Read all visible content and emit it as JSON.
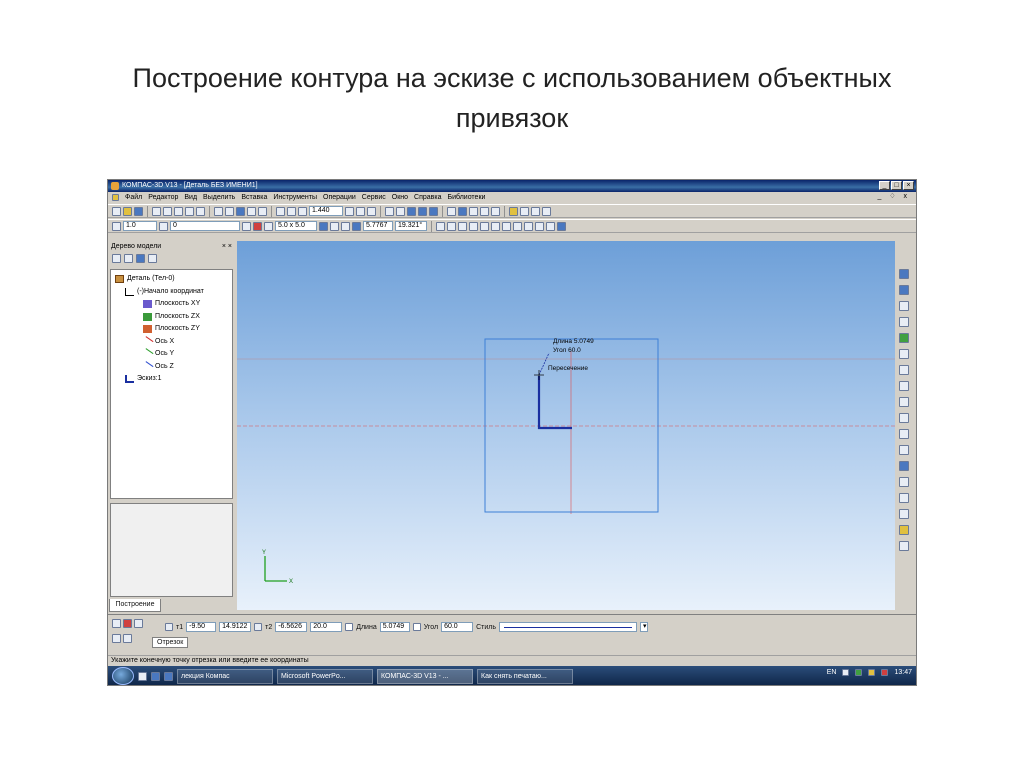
{
  "slide": {
    "title_line1": "Построение  контура на эскизе с использованием объектных",
    "title_line2": "привязок"
  },
  "window": {
    "title": "КОМПАС-3D V13 - [Деталь БЕЗ ИМЕНИ1]",
    "buttons": [
      "_",
      "□",
      "×"
    ]
  },
  "menu": {
    "items": [
      "Файл",
      "Редактор",
      "Вид",
      "Выделить",
      "Вставка",
      "Инструменты",
      "Операции",
      "Сервис",
      "Окно",
      "Справка",
      "Библиотеки"
    ],
    "mdi": "_ ♢ x"
  },
  "toolbar1": {
    "zoom": "1.440"
  },
  "toolbar2": {
    "scale": "1.0",
    "layer": "0",
    "grid": "5.0 x 5.0",
    "step": "5.7767",
    "angle": "19.321°"
  },
  "tree": {
    "header": "Дерево модели",
    "close": "× ×",
    "nodes": [
      {
        "label": "Деталь (Тел-0)",
        "icon": "part-icon",
        "level": 0
      },
      {
        "label": "(-)Начало координат",
        "icon": "origin-icon",
        "level": 1
      },
      {
        "label": "Плоскость XY",
        "icon": "plane-xy-icon",
        "level": 2
      },
      {
        "label": "Плоскость ZX",
        "icon": "plane-zx-icon",
        "level": 2
      },
      {
        "label": "Плоскость ZY",
        "icon": "plane-zy-icon",
        "level": 2
      },
      {
        "label": "Ось X",
        "icon": "axis-x-icon",
        "level": 2
      },
      {
        "label": "Ось Y",
        "icon": "axis-y-icon",
        "level": 2
      },
      {
        "label": "Ось Z",
        "icon": "axis-z-icon",
        "level": 2
      },
      {
        "label": "Эскиз:1",
        "icon": "sketch-icon",
        "level": 1
      }
    ],
    "tab": "Построение"
  },
  "canvas": {
    "length_hint": "Длина 5.0749",
    "angle_hint": "Угол 60.0",
    "snap_hint": "Пересечение",
    "axis_y": "Y",
    "axis_x": "X"
  },
  "props": {
    "p1_label": "т1",
    "p1_x": "-9.50",
    "p1_y": "14.9122",
    "p2_label": "т2",
    "p2_x": "-6.5626",
    "p2_y": "20.0",
    "length_label": "Длина",
    "length": "5.0749",
    "angle_label": "Угол",
    "angle": "60.0",
    "style_label": "Стиль",
    "tab": "Отрезок"
  },
  "status": "Укажите конечную точку отрезка или введите ее координаты",
  "taskbar": {
    "items": [
      "лекция Компас",
      "Microsoft PowerPo...",
      "КОМПАС-3D V13 - ...",
      "Как снять печатаю..."
    ],
    "lang": "EN",
    "time": "13:47"
  },
  "colors": {
    "title_bar": "#0a246a",
    "canvas_top": "#6d9fd8",
    "sketch_line": "#1a2fa0",
    "red_axis": "#e05050"
  }
}
